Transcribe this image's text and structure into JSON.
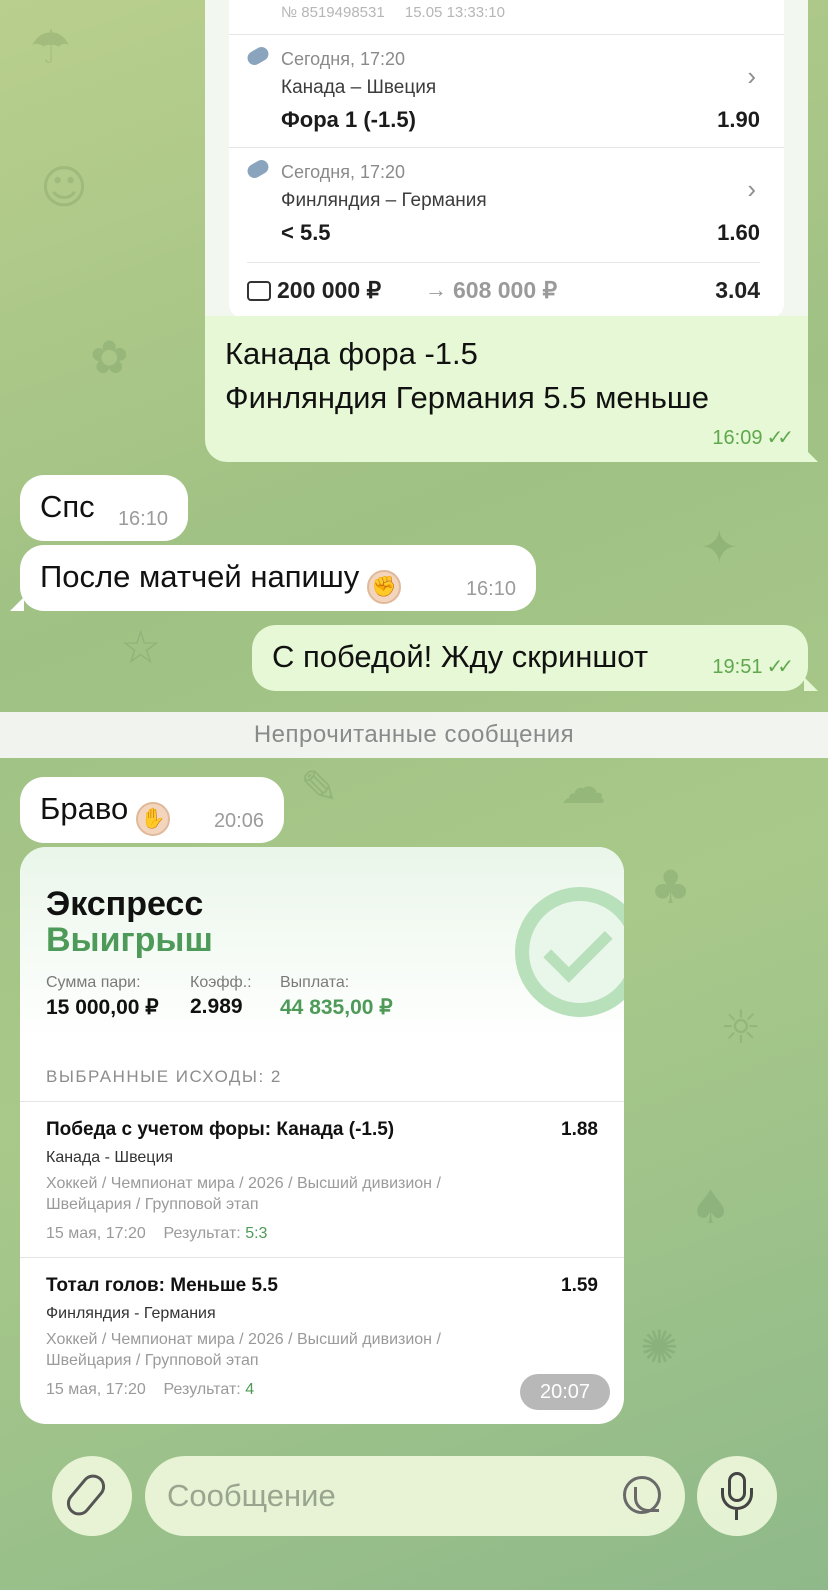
{
  "slip": {
    "header": "№ 8519498531",
    "header_time": "15.05 13:33:10",
    "bets": [
      {
        "time": "Сегодня, 17:20",
        "teams": "Канада – Швеция",
        "market": "Фора 1 (-1.5)",
        "odd": "1.90"
      },
      {
        "time": "Сегодня, 17:20",
        "teams": "Финляндия – Германия",
        "market": "< 5.5",
        "odd": "1.60"
      }
    ],
    "stake": "200 000 ₽",
    "arrow": "→",
    "potential_win": "608 000 ₽",
    "total_odd": "3.04"
  },
  "messages": {
    "out_caption_line1": "Канада фора -1.5",
    "out_caption_line2": "Финляндия Германия 5.5 меньше",
    "out_caption_time": "16:09",
    "in1_text": "Спс",
    "in1_time": "16:10",
    "in2_text": "После матчей напишу",
    "in2_time": "16:10",
    "out2_text": "С победой! Жду скриншот",
    "out2_time": "19:51",
    "unread_label": "Непрочитанные сообщения",
    "in3_text": "Браво",
    "in3_time": "20:06",
    "card_time": "20:07"
  },
  "card": {
    "title": "Экспресс",
    "status": "Выигрыш",
    "stake_label": "Сумма пари:",
    "stake_value": "15 000,00 ₽",
    "coef_label": "Коэфф.:",
    "coef_value": "2.989",
    "payout_label": "Выплата:",
    "payout_value": "44 835,00 ₽",
    "section": "ВЫБРАННЫЕ ИСХОДЫ: 2",
    "items": [
      {
        "market": "Победа с учетом форы: Канада (-1.5)",
        "koef": "1.88",
        "teams": "Канада - Швеция",
        "path1": "Хоккей / Чемпионат мира / 2026 / Высший дивизион /",
        "path2": "Швейцария / Групповой этап",
        "date": "15 мая, 17:20",
        "result_label": "Результат:",
        "result": "5:3"
      },
      {
        "market": "Тотал голов: Меньше 5.5",
        "koef": "1.59",
        "teams": "Финляндия - Германия",
        "path1": "Хоккей / Чемпионат мира / 2026 / Высший дивизион /",
        "path2": "Швейцария / Групповой этап",
        "date": "15 мая, 17:20",
        "result_label": "Результат:",
        "result": "4"
      }
    ]
  },
  "composer": {
    "placeholder": "Сообщение"
  },
  "colors": {
    "outgoing_bubble": "#e6f8d5",
    "incoming_bubble": "#ffffff",
    "win_green": "#4e9a58",
    "read_ticks": "#5fa84e"
  },
  "icons": [
    "wallet-icon",
    "chevron-right-icon",
    "checkmark-icon",
    "paperclip-icon",
    "sticker-icon",
    "microphone-icon",
    "double-check-icon"
  ]
}
